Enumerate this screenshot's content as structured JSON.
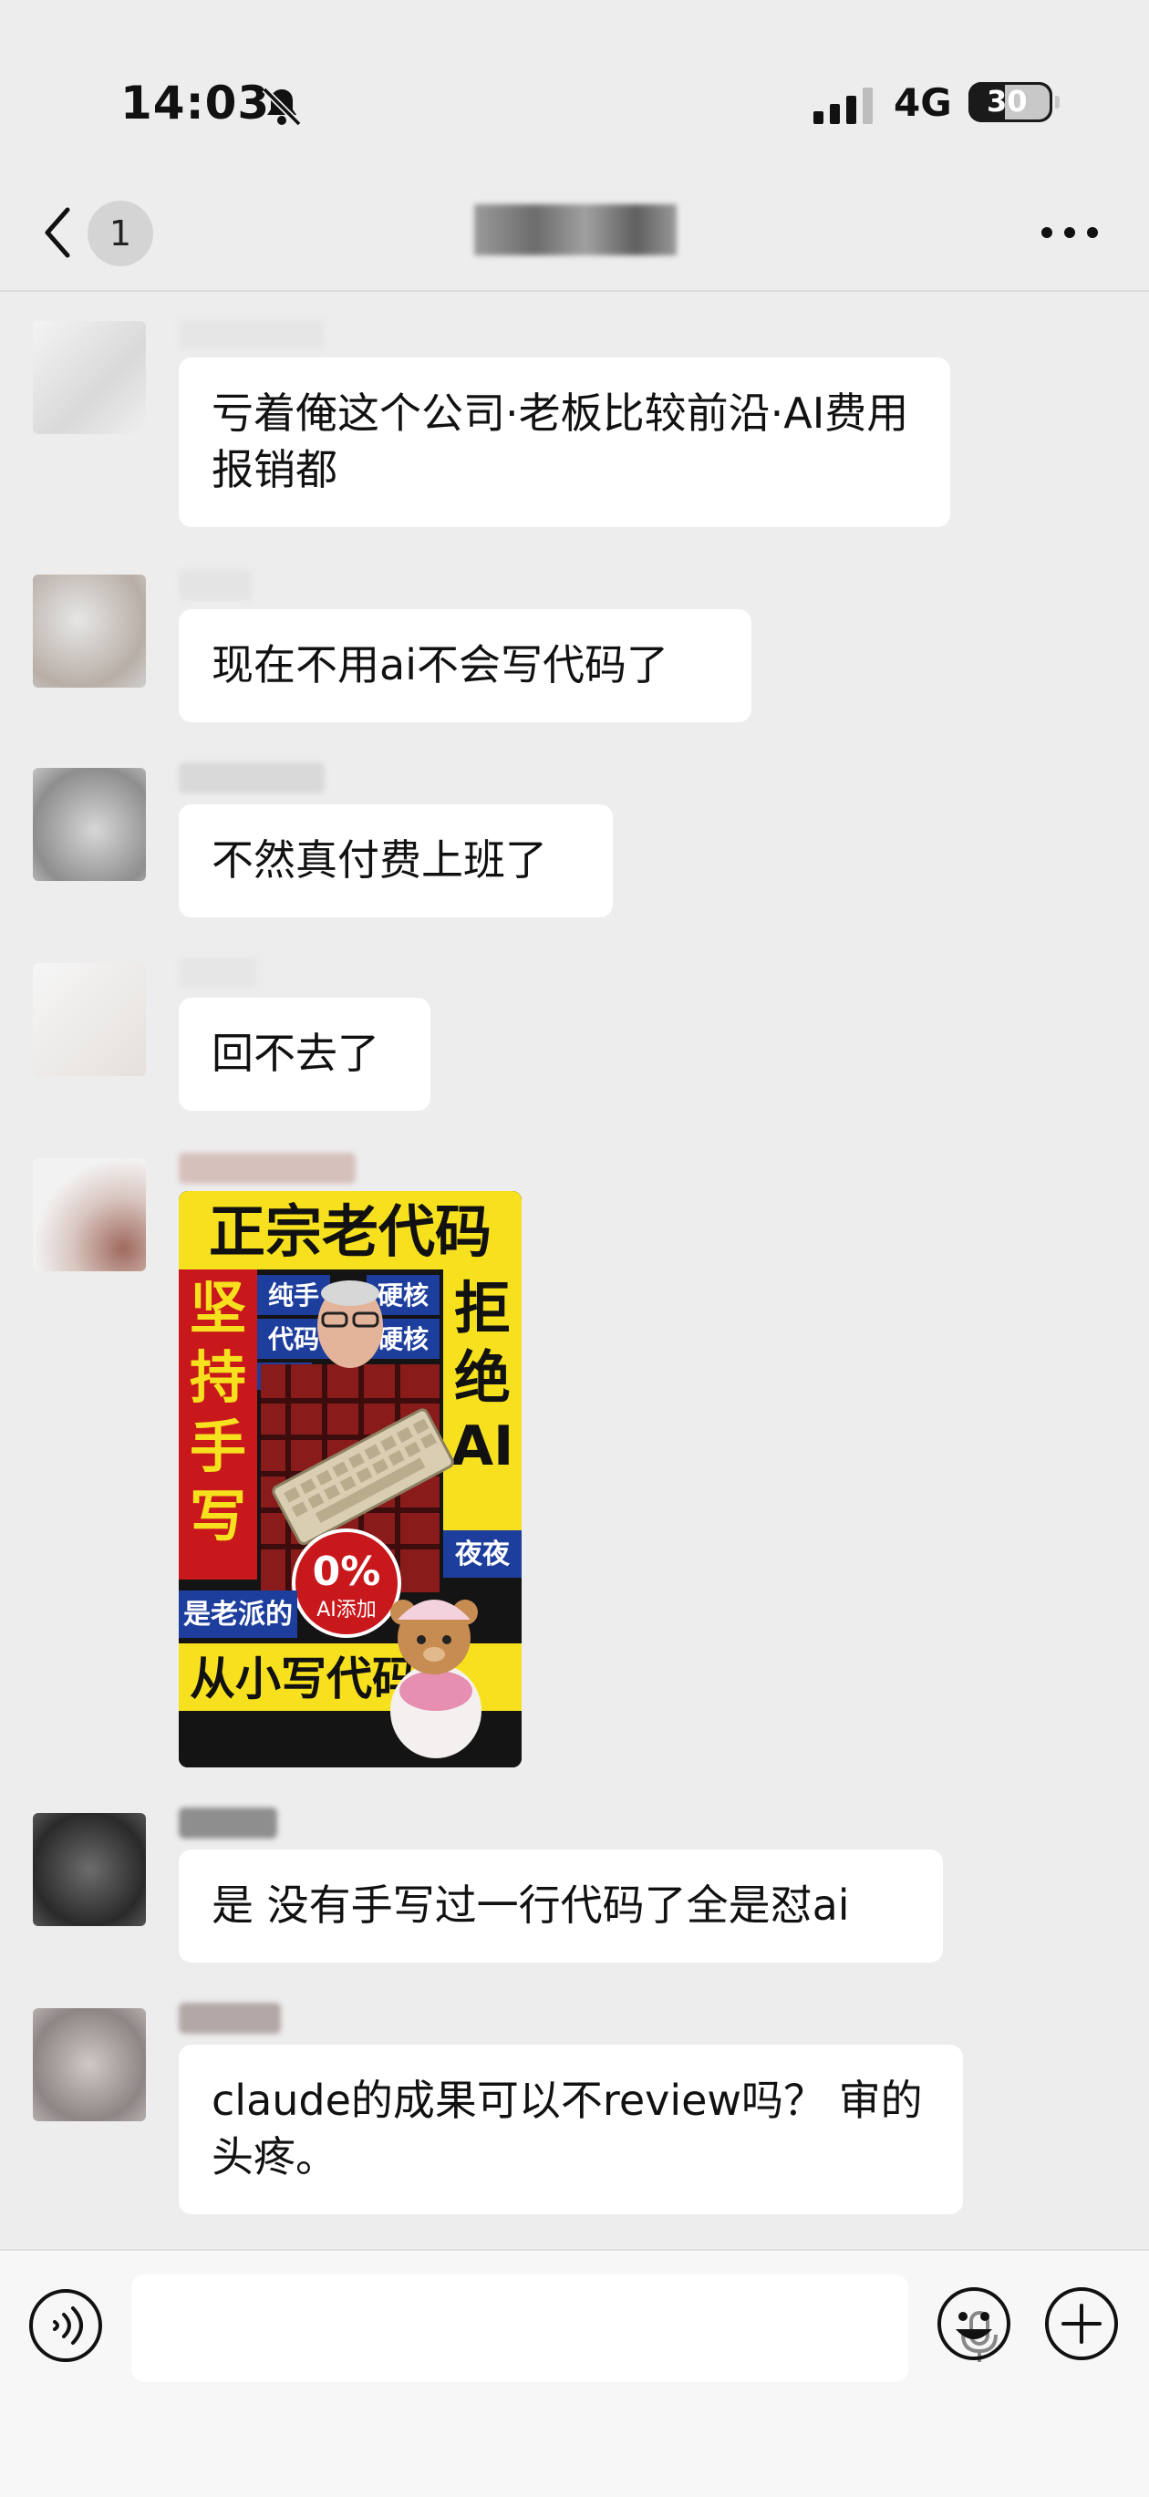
{
  "status_bar": {
    "time": "14:03",
    "network": "4G",
    "battery": "30",
    "icons": [
      "bell-slash-icon",
      "signal-icon",
      "battery-icon"
    ]
  },
  "nav": {
    "back_icon": "chevron-left-icon",
    "unread_count": "1",
    "more_icon": "ellipsis-icon"
  },
  "messages": [
    {
      "text": "亏着俺这个公司·老板比较前沿·AI费用报销都"
    },
    {
      "text": "现在不用ai不会写代码了"
    },
    {
      "text": "不然真付费上班了"
    },
    {
      "text": "回不去了"
    },
    {
      "type": "image",
      "poster": {
        "top_title": "正宗老代码",
        "left_vertical": [
          "坚",
          "持",
          "手",
          "写"
        ],
        "right_vertical": [
          "拒",
          "绝",
          "AI"
        ],
        "tags": [
          "纯手",
          "硬核",
          "代码",
          "硬核",
          "代码",
          "夜夜"
        ],
        "stamp_percent": "0%",
        "stamp_label": "AI添加",
        "left_bottom": "是老派的",
        "bottom_title": "从小写代码"
      }
    },
    {
      "text": "是 没有手写过一行代码了全是怼ai"
    },
    {
      "text": "claude的成果可以不review吗？ 审的头疼。"
    }
  ],
  "input_bar": {
    "placeholder": "",
    "icons": [
      "voice-icon",
      "microphone-icon",
      "emoji-icon",
      "plus-icon"
    ]
  }
}
